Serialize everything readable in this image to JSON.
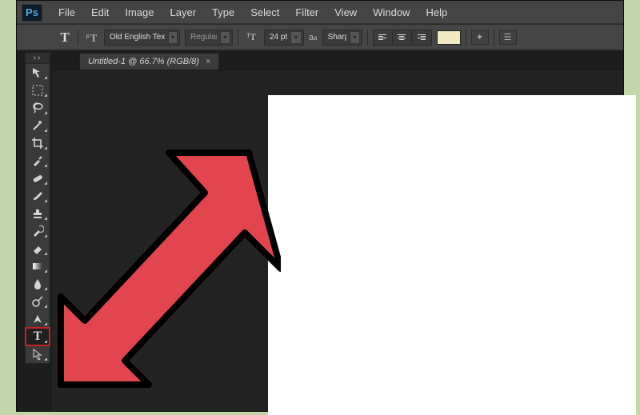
{
  "app": {
    "logo_text": "Ps"
  },
  "menu": [
    "File",
    "Edit",
    "Image",
    "Layer",
    "Type",
    "Select",
    "Filter",
    "View",
    "Window",
    "Help"
  ],
  "options": {
    "font_family": "Old English Text…",
    "font_style": "Regular",
    "font_size": "24 pt",
    "antialias": "Sharp",
    "color_swatch": "#f2eac2"
  },
  "document_tab": {
    "title": "Untitled-1 @ 66.7% (RGB/8)",
    "close_glyph": "×"
  },
  "tools": [
    {
      "name": "move-tool",
      "type": "svg-move",
      "sub": true
    },
    {
      "name": "marquee-tool",
      "type": "svg-marquee",
      "sub": true
    },
    {
      "name": "lasso-tool",
      "type": "svg-lasso",
      "sub": true
    },
    {
      "name": "quick-select-tool",
      "type": "svg-wand",
      "sub": true
    },
    {
      "name": "crop-tool",
      "type": "svg-crop",
      "sub": true
    },
    {
      "name": "eyedropper-tool",
      "type": "svg-eyedrop",
      "sub": true
    },
    {
      "name": "healing-brush-tool",
      "type": "svg-bandaid",
      "sub": true
    },
    {
      "name": "brush-tool",
      "type": "svg-brush",
      "sub": true
    },
    {
      "name": "clone-stamp-tool",
      "type": "svg-stamp",
      "sub": true
    },
    {
      "name": "history-brush-tool",
      "type": "svg-histbrush",
      "sub": true
    },
    {
      "name": "eraser-tool",
      "type": "svg-eraser",
      "sub": true
    },
    {
      "name": "gradient-tool",
      "type": "svg-gradient",
      "sub": true
    },
    {
      "name": "blur-tool",
      "type": "svg-blur",
      "sub": true
    },
    {
      "name": "dodge-tool",
      "type": "svg-dodge",
      "sub": true
    },
    {
      "name": "pen-tool",
      "type": "svg-pen",
      "sub": true
    },
    {
      "name": "type-tool",
      "type": "svg-type",
      "sub": true,
      "selected": true
    },
    {
      "name": "path-select-tool",
      "type": "svg-pathsel",
      "sub": true
    }
  ]
}
